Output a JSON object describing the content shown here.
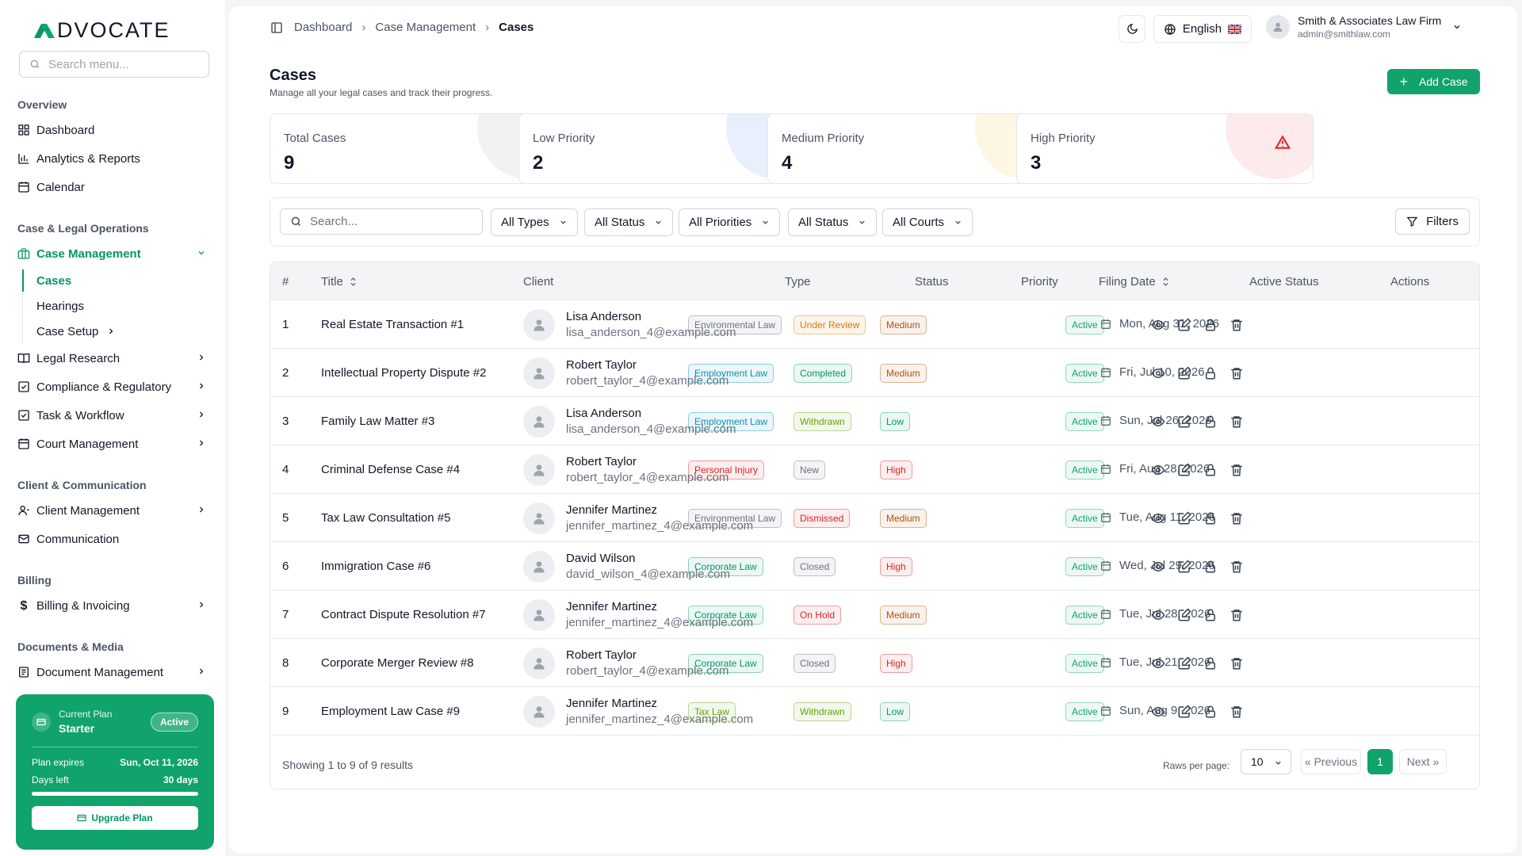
{
  "app": {
    "logo_text": "DVOCATE"
  },
  "sidebar": {
    "search_placeholder": "Search menu...",
    "sections": {
      "overview": "Overview",
      "case_legal": "Case & Legal Operations",
      "client_comm": "Client & Communication",
      "billing": "Billing",
      "docs": "Documents & Media"
    },
    "items": {
      "dashboard": "Dashboard",
      "analytics": "Analytics & Reports",
      "calendar": "Calendar",
      "case_management": "Case Management",
      "cases": "Cases",
      "hearings": "Hearings",
      "case_setup": "Case Setup",
      "legal_research": "Legal Research",
      "compliance": "Compliance & Regulatory",
      "task_workflow": "Task & Workflow",
      "court_management": "Court Management",
      "client_management": "Client Management",
      "communication": "Communication",
      "billing_invoicing": "Billing & Invoicing",
      "document_management": "Document Management"
    },
    "plan": {
      "label": "Current Plan",
      "name": "Starter",
      "badge": "Active",
      "expires_label": "Plan expires",
      "expires_value": "Sun, Oct 11, 2026",
      "days_label": "Days left",
      "days_value": "30 days",
      "upgrade_label": "Upgrade Plan",
      "progress_fraction": 1.0
    }
  },
  "header": {
    "breadcrumb": [
      "Dashboard",
      "Case Management",
      "Cases"
    ],
    "language": "English",
    "user_name": "Smith & Associates Law Firm",
    "user_email": "admin@smithlaw.com"
  },
  "page": {
    "title": "Cases",
    "subtitle": "Manage all your legal cases and track their progress.",
    "add_button": "Add Case"
  },
  "stats": [
    {
      "label": "Total Cases",
      "value": "9",
      "icon": "scale-icon",
      "color": "#6b7280"
    },
    {
      "label": "Low Priority",
      "value": "2",
      "icon": "trending-down-icon",
      "color": "#1d4ed8"
    },
    {
      "label": "Medium Priority",
      "value": "4",
      "icon": "gauge-icon",
      "color": "#d97706"
    },
    {
      "label": "High Priority",
      "value": "3",
      "icon": "alert-triangle-icon",
      "color": "#dc2626"
    }
  ],
  "filters": {
    "search_placeholder": "Search...",
    "types": "All Types",
    "status": "All Status",
    "priorities": "All Priorities",
    "status2": "All Status",
    "courts": "All Courts",
    "filters_button": "Filters"
  },
  "table": {
    "columns": {
      "num": "#",
      "title": "Title",
      "client": "Client",
      "type": "Type",
      "status": "Status",
      "priority": "Priority",
      "filing_date": "Filing Date",
      "active_status": "Active Status",
      "actions": "Actions"
    },
    "rows": [
      {
        "num": "1",
        "title": "Real Estate Transaction #1",
        "client": "Lisa Anderson",
        "email": "lisa_anderson_4@example.com",
        "type": "Environmental Law",
        "status": "Under Review",
        "priority": "Medium",
        "date": "Mon, Aug 31, 2026",
        "active": "Active"
      },
      {
        "num": "2",
        "title": "Intellectual Property Dispute #2",
        "client": "Robert Taylor",
        "email": "robert_taylor_4@example.com",
        "type": "Employment Law",
        "status": "Completed",
        "priority": "Medium",
        "date": "Fri, Jul 10, 2026",
        "active": "Active"
      },
      {
        "num": "3",
        "title": "Family Law Matter #3",
        "client": "Lisa Anderson",
        "email": "lisa_anderson_4@example.com",
        "type": "Employment Law",
        "status": "Withdrawn",
        "priority": "Low",
        "date": "Sun, Jul 26, 2026",
        "active": "Active"
      },
      {
        "num": "4",
        "title": "Criminal Defense Case #4",
        "client": "Robert Taylor",
        "email": "robert_taylor_4@example.com",
        "type": "Personal Injury",
        "status": "New",
        "priority": "High",
        "date": "Fri, Aug 28, 2026",
        "active": "Active"
      },
      {
        "num": "5",
        "title": "Tax Law Consultation #5",
        "client": "Jennifer Martinez",
        "email": "jennifer_martinez_4@example.com",
        "type": "Environmental Law",
        "status": "Dismissed",
        "priority": "Medium",
        "date": "Tue, Aug 11, 2026",
        "active": "Active"
      },
      {
        "num": "6",
        "title": "Immigration Case #6",
        "client": "David Wilson",
        "email": "david_wilson_4@example.com",
        "type": "Corporate Law",
        "status": "Closed",
        "priority": "High",
        "date": "Wed, Jul 29, 2026",
        "active": "Active"
      },
      {
        "num": "7",
        "title": "Contract Dispute Resolution #7",
        "client": "Jennifer Martinez",
        "email": "jennifer_martinez_4@example.com",
        "type": "Corporate Law",
        "status": "On Hold",
        "priority": "Medium",
        "date": "Tue, Jul 28, 2026",
        "active": "Active"
      },
      {
        "num": "8",
        "title": "Corporate Merger Review #8",
        "client": "Robert Taylor",
        "email": "robert_taylor_4@example.com",
        "type": "Corporate Law",
        "status": "Closed",
        "priority": "High",
        "date": "Tue, Jul 21, 2026",
        "active": "Active"
      },
      {
        "num": "9",
        "title": "Employment Law Case #9",
        "client": "Jennifer Martinez",
        "email": "jennifer_martinez_4@example.com",
        "type": "Tax Law",
        "status": "Withdrawn",
        "priority": "Low",
        "date": "Sun, Aug 9, 2026",
        "active": "Active"
      }
    ],
    "footer": {
      "showing": "Showing 1 to 9 of 9 results",
      "rows_per_page_label": "Raws per page:",
      "rows_per_page": "10",
      "previous": "« Previous",
      "current_page": "1",
      "next": "Next »"
    }
  },
  "colors": {
    "accent": "#10a36c",
    "badge_types": {
      "Environmental Law": "#6b7280",
      "Employment Law": "#0891b2",
      "Personal Injury": "#dc2626",
      "Corporate Law": "#059669",
      "Tax Law": "#65a30d"
    },
    "badge_status": {
      "Under Review": "#d97706",
      "Completed": "#059669",
      "Withdrawn": "#65a30d",
      "New": "#6b7280",
      "Dismissed": "#dc2626",
      "Closed": "#6b7280",
      "On Hold": "#dc2626"
    },
    "badge_priority": {
      "Medium": "#b45309",
      "Low": "#059669",
      "High": "#dc2626"
    }
  }
}
